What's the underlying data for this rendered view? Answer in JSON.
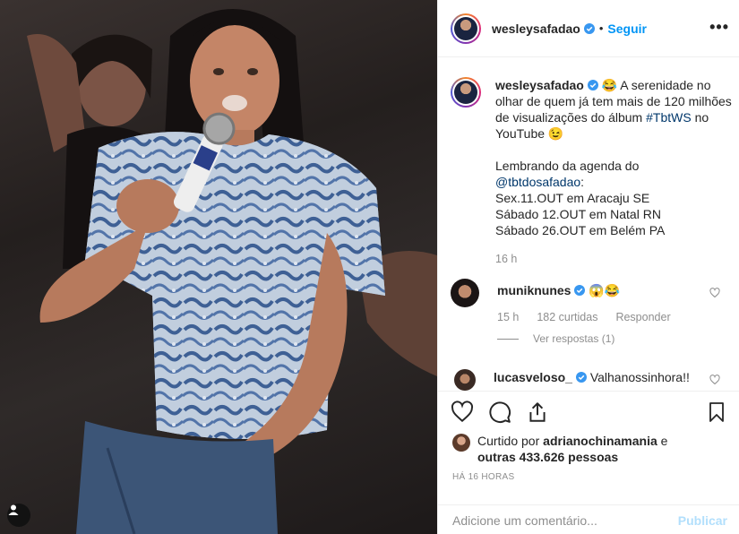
{
  "post": {
    "username": "wesleysafadao",
    "follow_label": "Seguir",
    "separator": "•",
    "more_label": "•••"
  },
  "caption": {
    "username": "wesleysafadao",
    "emoji_laugh": "😂",
    "line1": " A serenidade no olhar de quem já tem mais de 120 milhões de visualizações do álbum ",
    "hashtag": "#TbtWS",
    "line2": " no YouTube 😉",
    "agenda_intro": "Lembrando da agenda do",
    "mention": "@tbtdosafadao",
    "mention_suffix": ":",
    "dates": [
      "Sex.11.OUT em Aracaju SE",
      "Sábado 12.OUT em Natal RN",
      "Sábado 26.OUT em Belém PA"
    ],
    "time_ago": "16 h"
  },
  "comments": [
    {
      "username": "muniknunes",
      "text": " 😱😂",
      "time_ago": "15 h",
      "likes": "182 curtidas",
      "reply_label": "Responder",
      "view_replies": "Ver respostas (1)"
    },
    {
      "username": "lucasveloso_",
      "text": " Valhanossinhora!!"
    }
  ],
  "likes": {
    "prefix": "Curtido por ",
    "liker": "adrianochinamania",
    "middle": " e ",
    "others": "outras 433.626 pessoas"
  },
  "timestamp": "HÁ 16 HORAS",
  "comment_box": {
    "placeholder": "Adicione um comentário...",
    "publish_label": "Publicar"
  },
  "colors": {
    "accent": "#0095f6",
    "link": "#00376b",
    "muted": "#8e8e8e",
    "publish_disabled": "#b2dffc"
  },
  "icons": [
    "heart-icon",
    "comment-icon",
    "share-icon",
    "bookmark-icon",
    "verified-icon",
    "more-icon",
    "user-tag-icon"
  ]
}
